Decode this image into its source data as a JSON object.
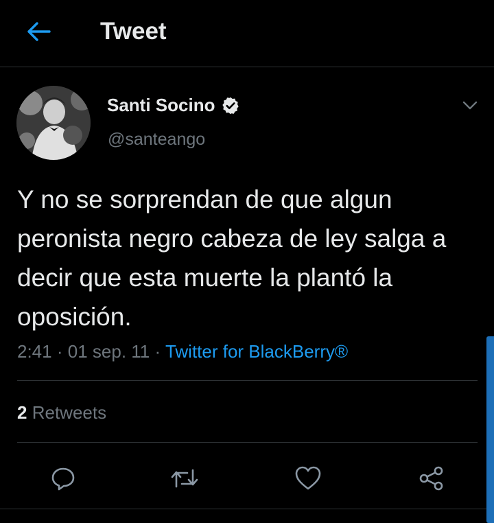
{
  "header": {
    "title": "Tweet",
    "back_icon": "arrow-left-icon",
    "accent": "#1d9bf0"
  },
  "tweet": {
    "author": {
      "name": "Santi Socino",
      "handle": "@santeango",
      "verified": true,
      "verified_icon": "verified-badge-icon"
    },
    "text": "Y no se sorprendan de que algun peronista negro cabeza de ley salga a decir que esta muerte la plantó la oposición.",
    "time": "2:41",
    "separator": "·",
    "date": "01 sep. 11",
    "source": "Twitter for BlackBerry®",
    "caret_icon": "chevron-down-icon"
  },
  "stats": {
    "retweet_count": "2",
    "retweet_label": "Retweets"
  },
  "actions": [
    {
      "name": "reply",
      "icon": "reply-icon"
    },
    {
      "name": "retweet",
      "icon": "retweet-icon"
    },
    {
      "name": "like",
      "icon": "heart-icon"
    },
    {
      "name": "share",
      "icon": "share-icon"
    }
  ],
  "colors": {
    "background": "#000000",
    "text": "#e7e9ea",
    "secondary": "#6e767d",
    "divider": "#2f3336",
    "link": "#1d9bf0"
  }
}
